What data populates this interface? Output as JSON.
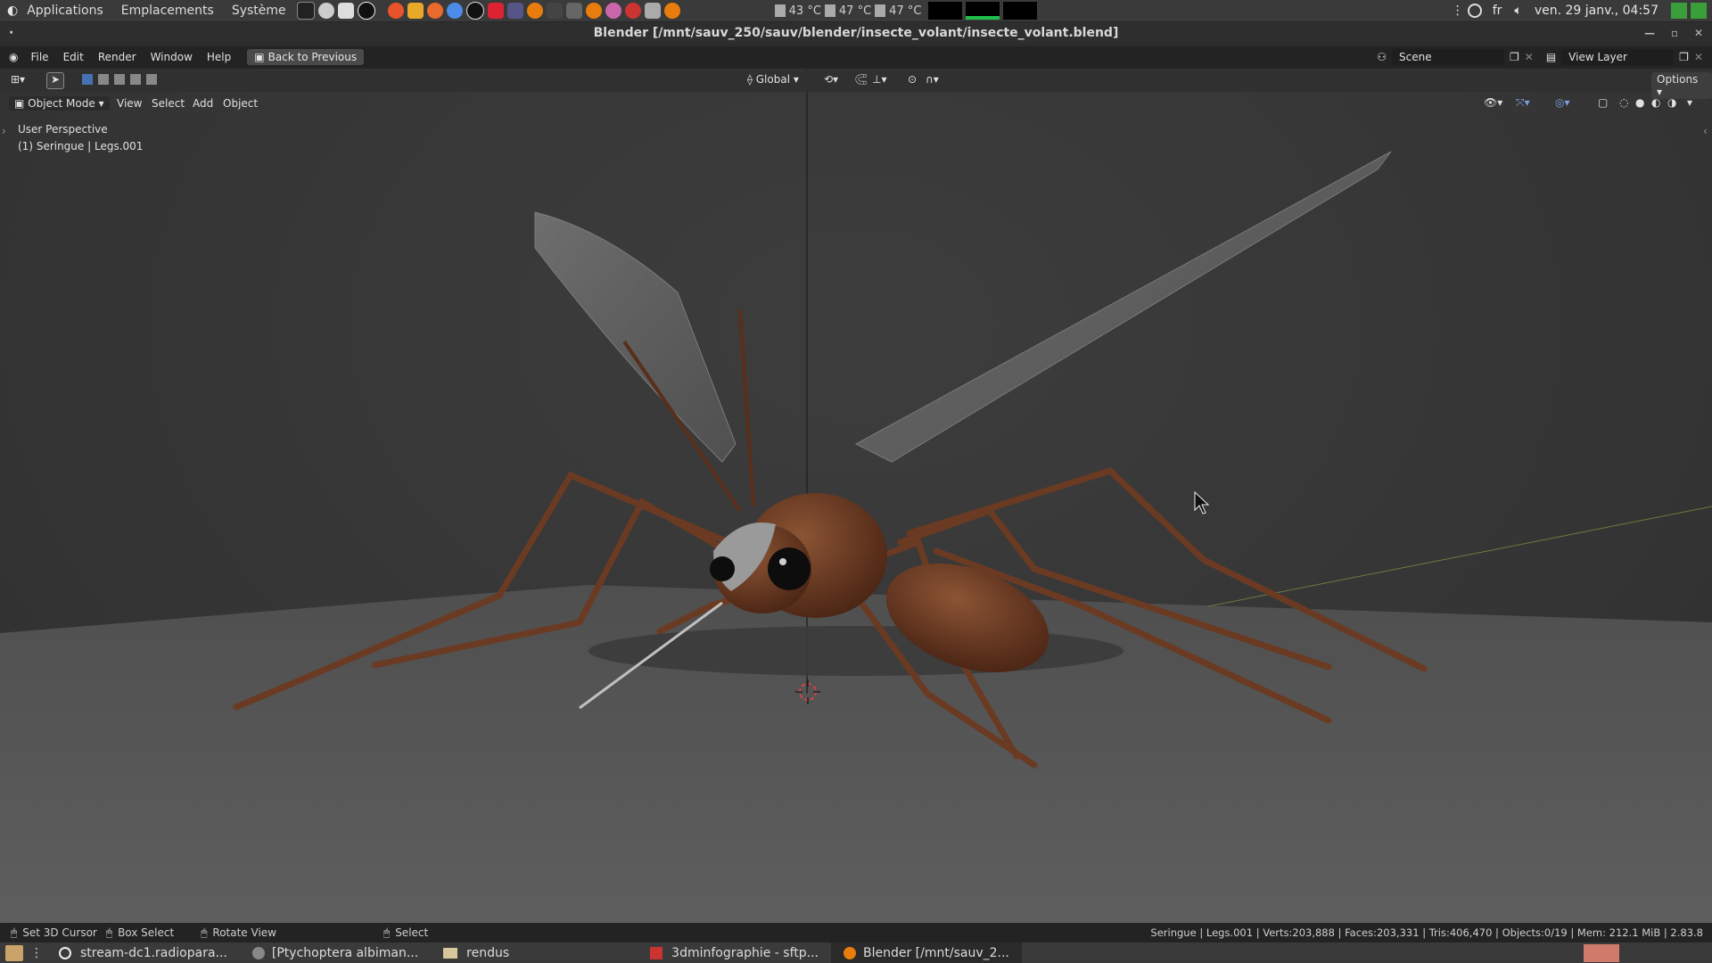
{
  "system_panel": {
    "menus": [
      "Applications",
      "Emplacements",
      "Système"
    ],
    "temps": [
      "43 °C",
      "47 °C",
      "47 °C"
    ],
    "keyboard_layout": "fr",
    "clock": "ven. 29 janv., 04:57"
  },
  "window": {
    "title": "Blender [/mnt/sauv_250/sauv/blender/insecte_volant/insecte_volant.blend]"
  },
  "topbar": {
    "menus": [
      "File",
      "Edit",
      "Render",
      "Window",
      "Help"
    ],
    "back_button": "Back to Previous",
    "scene": "Scene",
    "view_layer": "View Layer"
  },
  "toolheader": {
    "orientation": "Global",
    "options": "Options"
  },
  "viewport_header": {
    "mode": "Object Mode",
    "menus": [
      "View",
      "Select",
      "Add",
      "Object"
    ]
  },
  "viewport": {
    "perspective": "User Perspective",
    "active_object": "(1) Seringue | Legs.001"
  },
  "statusbar": {
    "hints": [
      "Set 3D Cursor",
      "Box Select",
      "Rotate View",
      "Select"
    ],
    "stats": "Seringue | Legs.001 | Verts:203,888 | Faces:203,331 | Tris:406,470 | Objects:0/19 | Mem: 212.1 MiB | 2.83.8"
  },
  "taskbar": {
    "tasks": [
      "stream-dc1.radiopara...",
      "[Ptychoptera albiman...",
      "rendus",
      "3dminfographie - sftp...",
      "Blender [/mnt/sauv_2..."
    ]
  },
  "colors": {
    "insect_body": "#6b3a22",
    "wing": "#8a8a8a",
    "floor": "#5a5a5a",
    "accent": "#4772b3"
  }
}
